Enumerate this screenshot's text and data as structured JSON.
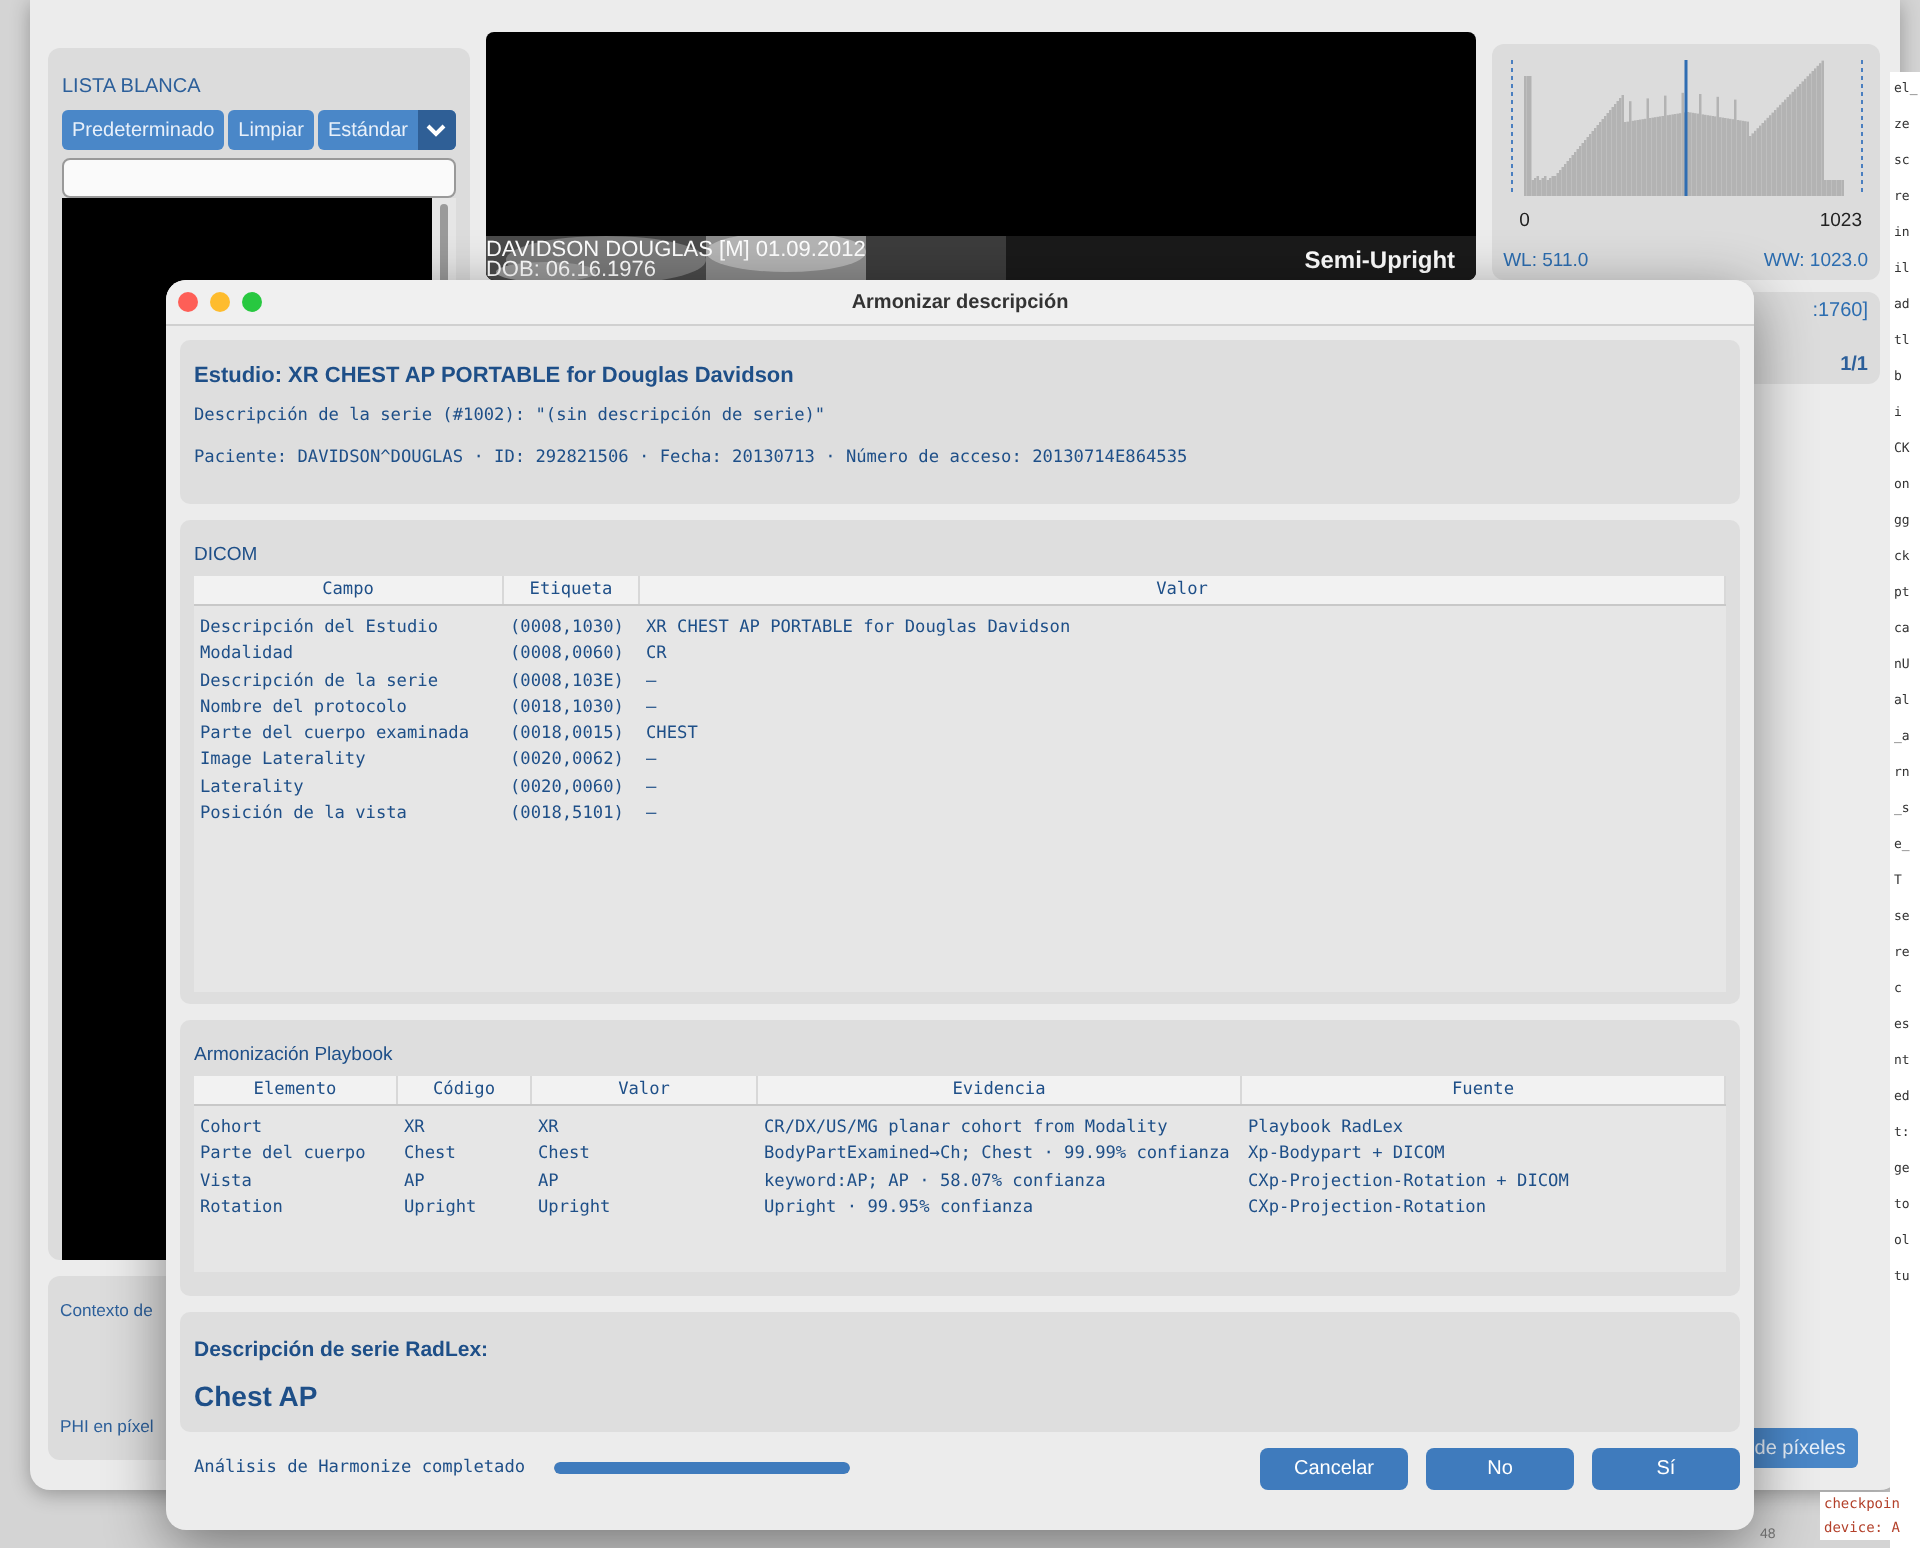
{
  "background_window": {
    "whitelist": {
      "title": "LISTA BLANCA",
      "buttons": [
        "Predeterminado",
        "Limpiar"
      ],
      "preset": {
        "value": "Estándar"
      }
    },
    "viewer": {
      "overlay_name": "DAVIDSON DOUGLAS [M] 01.09.2012",
      "overlay_dob": "DOB: 06.16.1976",
      "overlay_view": "Semi-Upright"
    },
    "histogram": {
      "min_label": "0",
      "max_label": "1023",
      "wl": "WL: 511.0",
      "ww": "WW: 1023.0"
    },
    "info_card": {
      "range": ":1760]",
      "count": "1/1"
    },
    "context_panel": {
      "label": "Contexto de",
      "phi_label": "PHI en píxel",
      "button": "de píxeles"
    }
  },
  "editor": {
    "lines": [
      "el_",
      "ze",
      "sc",
      "re",
      "in",
      "il",
      "ad",
      "tl",
      "b",
      "i",
      "CK",
      "on",
      "gg",
      "ck",
      "pt",
      "ca",
      "nU",
      "al",
      "_a",
      "rn",
      "_s",
      "e_",
      "T",
      "se",
      "re",
      "c",
      "es",
      "nt",
      "ed",
      "t:",
      "ge",
      "to",
      "ol",
      "tu"
    ],
    "bottom_lines": [
      "checkpoin",
      "device: A"
    ],
    "line_number": "48"
  },
  "dialog": {
    "title": "Armonizar descripción",
    "summary": {
      "heading": "Estudio: XR CHEST AP PORTABLE for Douglas Davidson",
      "series": "Descripción de la serie (#1002): \"(sin descripción de serie)\"",
      "patient": "Paciente: DAVIDSON^DOUGLAS · ID: 292821506 · Fecha: 20130713 · Número de acceso: 20130714E864535"
    },
    "dicom": {
      "title": "DICOM",
      "columns": [
        "Campo",
        "Etiqueta",
        "Valor"
      ],
      "rows": [
        [
          "Descripción del Estudio",
          "(0008,1030)",
          "XR CHEST AP PORTABLE for Douglas Davidson"
        ],
        [
          "Modalidad",
          "(0008,0060)",
          "CR"
        ],
        [
          "Descripción de la serie",
          "(0008,103E)",
          "—"
        ],
        [
          "Nombre del protocolo",
          "(0018,1030)",
          "—"
        ],
        [
          "Parte del cuerpo examinada",
          "(0018,0015)",
          "CHEST"
        ],
        [
          "Image Laterality",
          "(0020,0062)",
          "—"
        ],
        [
          "Laterality",
          "(0020,0060)",
          "—"
        ],
        [
          "Posición de la vista",
          "(0018,5101)",
          "—"
        ]
      ]
    },
    "playbook": {
      "title": "Armonización Playbook",
      "columns": [
        "Elemento",
        "Código",
        "Valor",
        "Evidencia",
        "Fuente"
      ],
      "rows": [
        [
          "Cohort",
          "XR",
          "XR",
          "CR/DX/US/MG planar cohort from Modality",
          "Playbook RadLex"
        ],
        [
          "Parte del cuerpo",
          "Chest",
          "Chest",
          "BodyPartExamined→Ch; Chest · 99.99% confianza",
          "Xp-Bodypart + DICOM"
        ],
        [
          "Vista",
          "AP",
          "AP",
          "keyword:AP; AP · 58.07% confianza",
          "CXp-Projection-Rotation + DICOM"
        ],
        [
          "Rotation",
          "Upright",
          "Upright",
          "Upright · 99.95% confianza",
          "CXp-Projection-Rotation"
        ]
      ]
    },
    "radlex": {
      "label": "Descripción de serie RadLex:",
      "value": "Chest AP"
    },
    "status": "Análisis de Harmonize completado",
    "progress": {
      "level": 1.0
    },
    "buttons": [
      "Cancelar",
      "No",
      "Sí"
    ]
  }
}
